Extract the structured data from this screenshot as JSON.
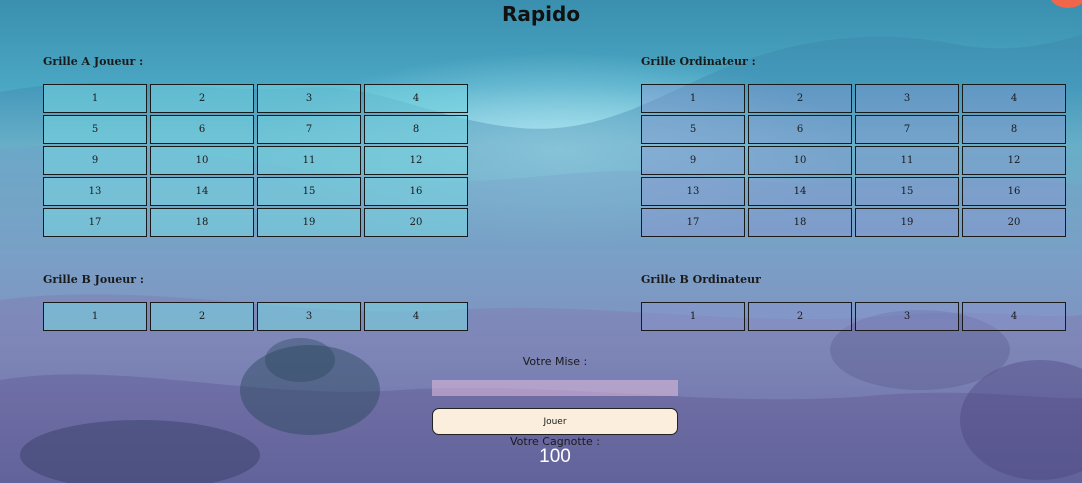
{
  "app": {
    "title": "Rapido"
  },
  "grids": {
    "a_player": {
      "label": "Grille A Joueur :",
      "cells": [
        "1",
        "2",
        "3",
        "4",
        "5",
        "6",
        "7",
        "8",
        "9",
        "10",
        "11",
        "12",
        "13",
        "14",
        "15",
        "16",
        "17",
        "18",
        "19",
        "20"
      ]
    },
    "a_computer": {
      "label": "Grille Ordinateur :",
      "cells": [
        "1",
        "2",
        "3",
        "4",
        "5",
        "6",
        "7",
        "8",
        "9",
        "10",
        "11",
        "12",
        "13",
        "14",
        "15",
        "16",
        "17",
        "18",
        "19",
        "20"
      ]
    },
    "b_player": {
      "label": "Grille B Joueur :",
      "cells": [
        "1",
        "2",
        "3",
        "4"
      ]
    },
    "b_computer": {
      "label": "Grille B Ordinateur",
      "cells": [
        "1",
        "2",
        "3",
        "4"
      ]
    }
  },
  "bet": {
    "label": "Votre Mise :",
    "value": "",
    "placeholder": ""
  },
  "play_button": {
    "label": "Jouer"
  },
  "jackpot": {
    "label": "Votre Cagnotte :",
    "value": "100"
  },
  "colors": {
    "background_top": "#3a8fae",
    "background_bottom": "#5f4f8a",
    "button_bg": "#fbeedd",
    "accent_dot": "#f0664b",
    "jackpot_value": "#ffffff"
  }
}
